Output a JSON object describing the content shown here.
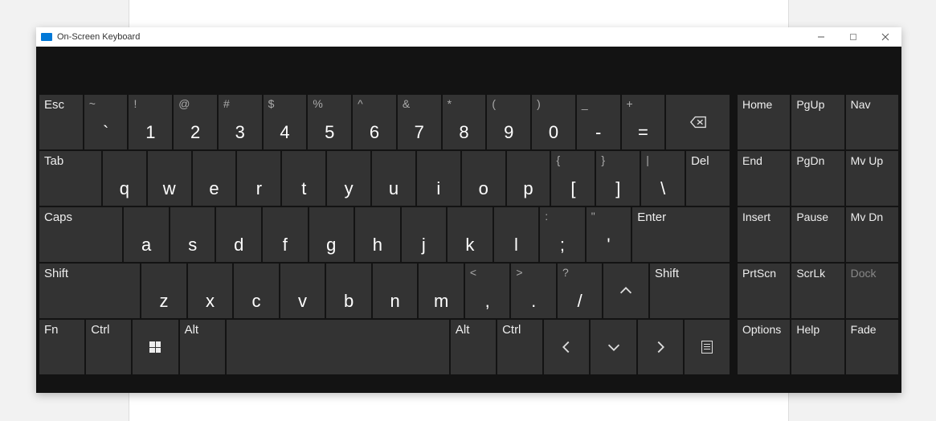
{
  "window": {
    "title": "On-Screen Keyboard"
  },
  "rows": {
    "r1": {
      "esc": "Esc",
      "k": [
        {
          "u": "~",
          "l": "`"
        },
        {
          "u": "!",
          "l": "1"
        },
        {
          "u": "@",
          "l": "2"
        },
        {
          "u": "#",
          "l": "3"
        },
        {
          "u": "$",
          "l": "4"
        },
        {
          "u": "%",
          "l": "5"
        },
        {
          "u": "^",
          "l": "6"
        },
        {
          "u": "&",
          "l": "7"
        },
        {
          "u": "*",
          "l": "8"
        },
        {
          "u": "(",
          "l": "9"
        },
        {
          "u": ")",
          "l": "0"
        },
        {
          "u": "_",
          "l": "-"
        },
        {
          "u": "+",
          "l": "="
        }
      ]
    },
    "r2": {
      "tab": "Tab",
      "letters": [
        "q",
        "w",
        "e",
        "r",
        "t",
        "y",
        "u",
        "i",
        "o",
        "p"
      ],
      "k": [
        {
          "u": "{",
          "l": "["
        },
        {
          "u": "}",
          "l": "]"
        },
        {
          "u": "|",
          "l": "\\"
        }
      ],
      "del": "Del"
    },
    "r3": {
      "caps": "Caps",
      "letters": [
        "a",
        "s",
        "d",
        "f",
        "g",
        "h",
        "j",
        "k",
        "l"
      ],
      "k": [
        {
          "u": ":",
          "l": ";"
        },
        {
          "u": "\"",
          "l": "'"
        }
      ],
      "enter": "Enter"
    },
    "r4": {
      "shiftL": "Shift",
      "letters": [
        "z",
        "x",
        "c",
        "v",
        "b",
        "n",
        "m"
      ],
      "k": [
        {
          "u": "<",
          "l": ","
        },
        {
          "u": ">",
          "l": "."
        },
        {
          "u": "?",
          "l": "/"
        }
      ],
      "shiftR": "Shift"
    },
    "r5": {
      "fn": "Fn",
      "ctrlL": "Ctrl",
      "altL": "Alt",
      "altR": "Alt",
      "ctrlR": "Ctrl"
    }
  },
  "side": {
    "r1": [
      "Home",
      "PgUp",
      "Nav"
    ],
    "r2": [
      "End",
      "PgDn",
      "Mv Up"
    ],
    "r3": [
      "Insert",
      "Pause",
      "Mv Dn"
    ],
    "r4": [
      "PrtScn",
      "ScrLk",
      "Dock"
    ],
    "r5": [
      "Options",
      "Help",
      "Fade"
    ]
  }
}
